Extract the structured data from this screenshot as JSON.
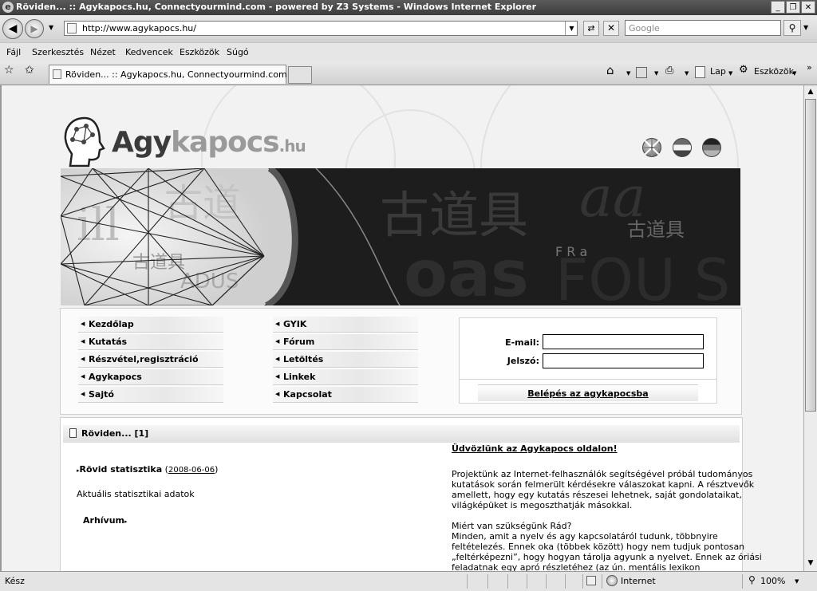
{
  "window": {
    "title": "Röviden... :: Agykapocs.hu, Connectyourmind.com - powered by Z3 Systems - Windows Internet Explorer",
    "buttons": {
      "minimize": "_",
      "maximize": "❐",
      "close": "✕"
    }
  },
  "address_bar": {
    "url": "http://www.agykapocs.hu/",
    "search_placeholder": "Google"
  },
  "menu": [
    "Fájl",
    "Szerkesztés",
    "Nézet",
    "Kedvencek",
    "Eszközök",
    "Súgó"
  ],
  "tab": {
    "title": "Röviden... :: Agykapocs.hu, Connectyourmind.com - ..."
  },
  "toolbar": {
    "page": "Lap",
    "tools": "Eszközök"
  },
  "page": {
    "logo": {
      "part1": "Agy",
      "part2": "kapocs",
      "part3": ".hu"
    },
    "nav_left": [
      "Kezdőlap",
      "Kutatás",
      "Részvétel,regisztráció",
      "Agykapocs",
      "Sajtó"
    ],
    "nav_right": [
      "GYIK",
      "Fórum",
      "Letöltés",
      "Linkek",
      "Kapcsolat"
    ],
    "login": {
      "email_label": "E-mail:",
      "password_label": "Jelszó:",
      "button": "Belépés az agykapocsba"
    },
    "section_title": "Röviden... [1]",
    "stats_link": "Rövid statisztika",
    "stats_date": "2008-06-06",
    "stats_desc": "Aktuális statisztikai adatok",
    "archive": "Arhívum",
    "welcome": "Üdvözlünk az Agykapocs oldalon!",
    "para1": [
      "Projektünk az Internet-felhasználók segítségével próbál tudományos",
      "kutatások során felmerült kérdésekre válaszokat kapni. A résztvevők",
      "amellett, hogy egy kutatás részesei lehetnek, saját gondolataikat,",
      "világképüket is megoszthatják másokkal."
    ],
    "para2": [
      "Miért van szükségünk Rád?",
      "Minden, amit a nyelv és agy kapcsolatáról tudunk, többnyire",
      "feltételezés. Ennek oka (többek között) hogy nem tudjuk pontosan",
      "„feltérképezni”, hogy hogyan tárolja agyunk a nyelvet. Ennek az óriási",
      "feladatnak egy apró részletéhez (az ún. mentális lexikon"
    ]
  },
  "status": {
    "text": "Kész",
    "zone": "Internet",
    "zoom": "100%"
  }
}
